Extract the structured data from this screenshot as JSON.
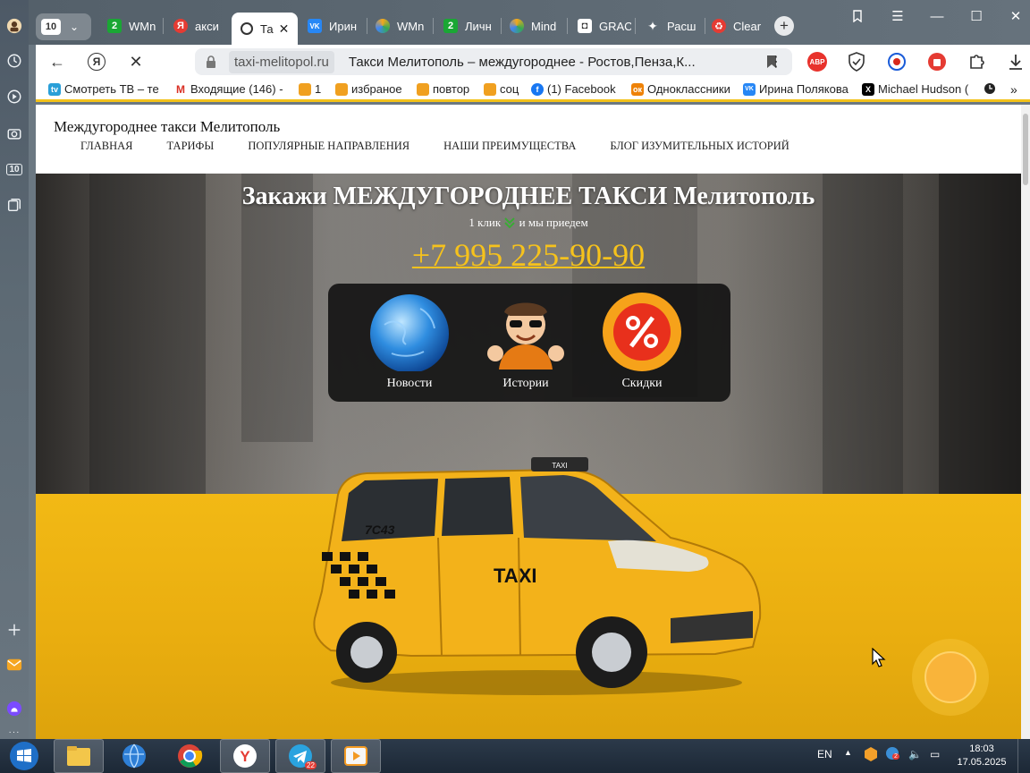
{
  "browser": {
    "tab_count": "10",
    "tabs": [
      {
        "label": "WMn",
        "icon": "2",
        "color": "#1aa734"
      },
      {
        "label": "акси",
        "icon": "Я",
        "color": "#e53b33"
      },
      {
        "label": "Та",
        "icon": "O",
        "color": "#ffffff"
      },
      {
        "label": "Ирин",
        "icon": "VK",
        "color": "#2787f5"
      },
      {
        "label": "WMn",
        "icon": "G",
        "color": "#f4a81c"
      },
      {
        "label": "Личн",
        "icon": "2",
        "color": "#1aa734"
      },
      {
        "label": "Mind",
        "icon": "G",
        "color": "#f4a81c"
      },
      {
        "label": "GRAC",
        "icon": "◘",
        "color": "#ffffff"
      },
      {
        "label": "Расш",
        "icon": "✦",
        "color": "#ffffff"
      },
      {
        "label": "Clear",
        "icon": "♻",
        "color": "#e53b33"
      }
    ],
    "url_host": "taxi-melitopol.ru",
    "page_title": "Такси Мелитополь – междугороднее - Ростов,Пенза,К...",
    "extensions": [
      "ABP"
    ],
    "bookmarks": [
      {
        "label": "Смотреть ТВ – те",
        "color": "#2a9fd8"
      },
      {
        "label": "Входящие (146) -",
        "color": "#d93025"
      },
      {
        "label": "1",
        "color": "#f0a020"
      },
      {
        "label": "избраное",
        "color": "#f0a020"
      },
      {
        "label": "повтор",
        "color": "#f0a020"
      },
      {
        "label": "соц",
        "color": "#f0a020"
      },
      {
        "label": "(1) Facebook",
        "color": "#1877f2"
      },
      {
        "label": "Одноклассники",
        "color": "#ee8208"
      },
      {
        "label": "Ирина Полякова",
        "color": "#2787f5"
      },
      {
        "label": "Michael Hudson (",
        "color": "#000000"
      }
    ]
  },
  "site": {
    "name": "Междугороднее такси Мелитополь",
    "nav": [
      "ГЛАВНАЯ",
      "ТАРИФЫ",
      "ПОПУЛЯРНЫЕ НАПРАВЛЕНИЯ",
      "НАШИ ПРЕИМУЩЕСТВА",
      "БЛОГ ИЗУМИТЕЛЬНЫХ ИСТОРИЙ"
    ],
    "headline": "Закажи МЕЖДУГОРОДНЕЕ ТАКСИ Мелитополь",
    "sub_pre": "1 клик",
    "sub_post": "и мы приедем",
    "phone": "+7 995 225-90-90",
    "panel": [
      "Новости",
      "Истории",
      "Скидки"
    ],
    "car_plate": "7С43",
    "car_sign": "TAXI",
    "roof_sign": "TAXI"
  },
  "taskbar": {
    "lang": "EN",
    "badge": "22",
    "tray_badge": "2",
    "time": "18:03",
    "date": "17.05.2025"
  },
  "colors": {
    "accent": "#f3c21a",
    "phone": "#f6c21c"
  }
}
